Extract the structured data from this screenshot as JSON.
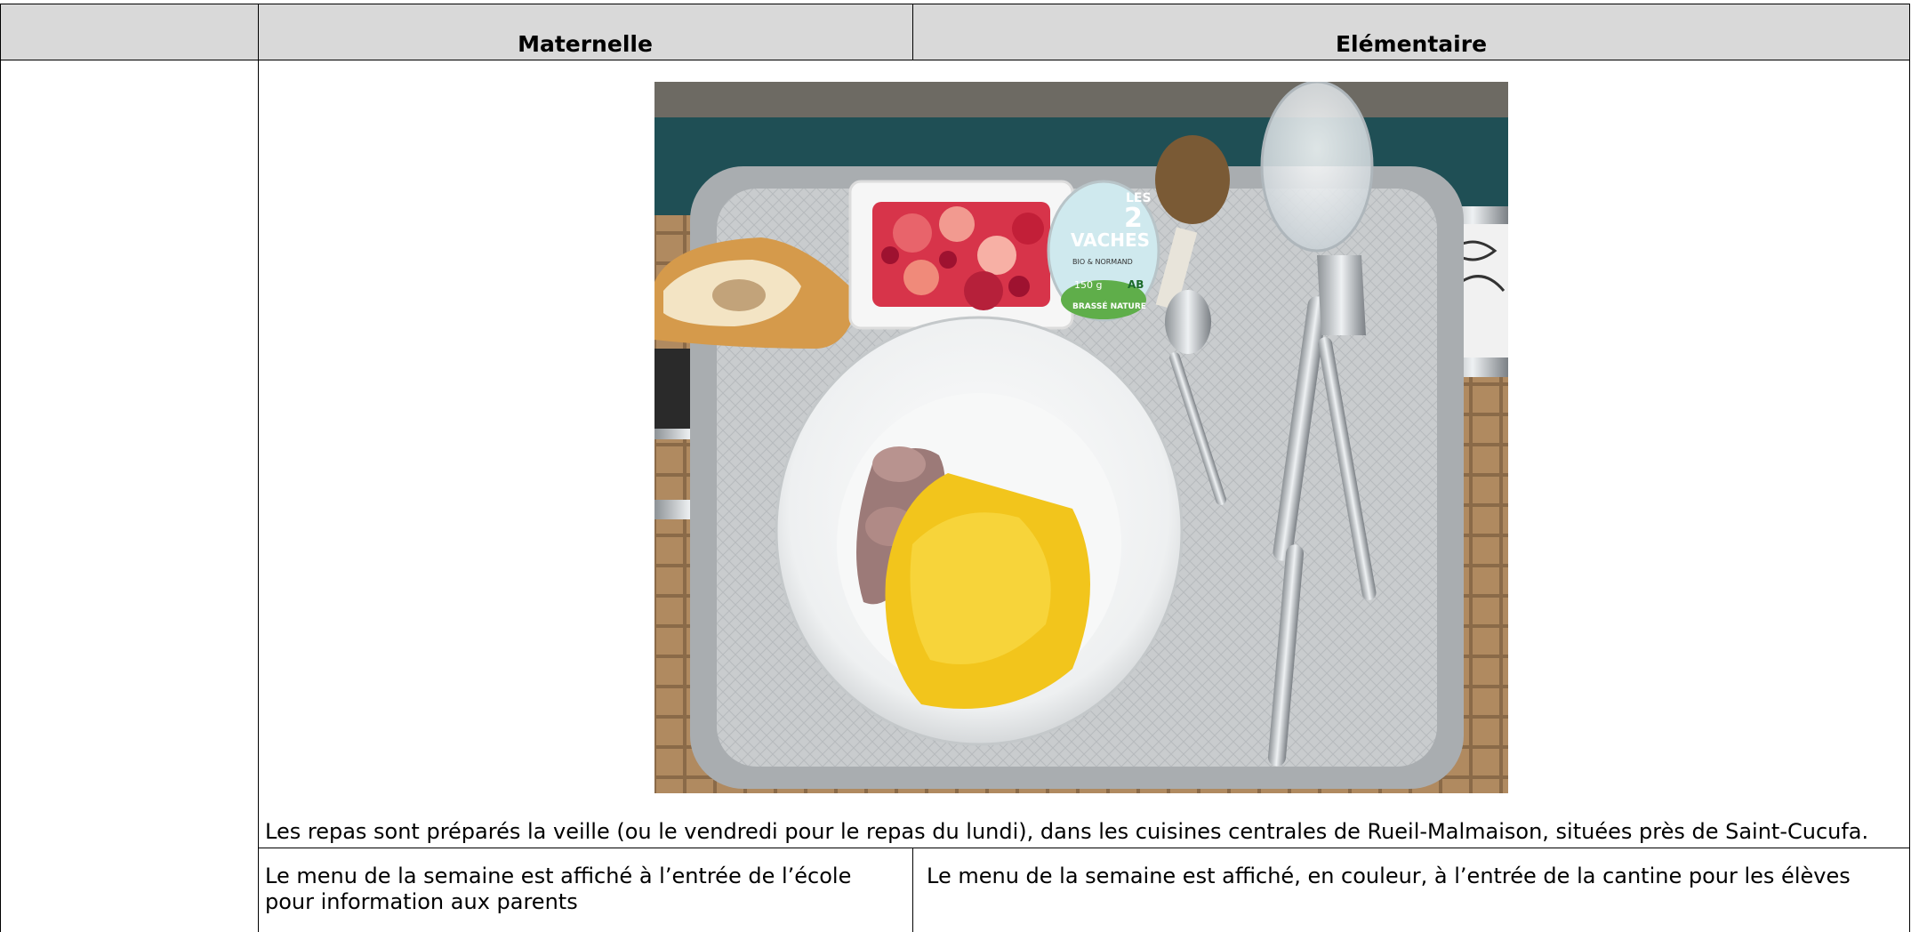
{
  "table": {
    "headers": {
      "empty": "",
      "maternelle": "Maternelle",
      "elementaire": "Elémentaire"
    },
    "photo": {
      "yogurt_brand_line1": "LES",
      "yogurt_brand_line2": "2",
      "yogurt_brand_line3": "VACHES",
      "yogurt_sub": "BIO & NORMAND",
      "yogurt_weight": "150 g",
      "yogurt_label": "BRASSÉ NATURE",
      "yogurt_ab": "AB"
    },
    "preparation_note": "Les repas sont préparés la veille (ou le vendredi pour le repas du lundi), dans les cuisines centrales de Rueil-Malmaison, situées près de Saint-Cucufa.",
    "menu_maternelle": "Le menu de la semaine est affiché à l’entrée de l’école pour information aux parents",
    "menu_elementaire": "Le menu de la semaine est affiché, en couleur, à l’entrée de la cantine pour les élèves"
  }
}
